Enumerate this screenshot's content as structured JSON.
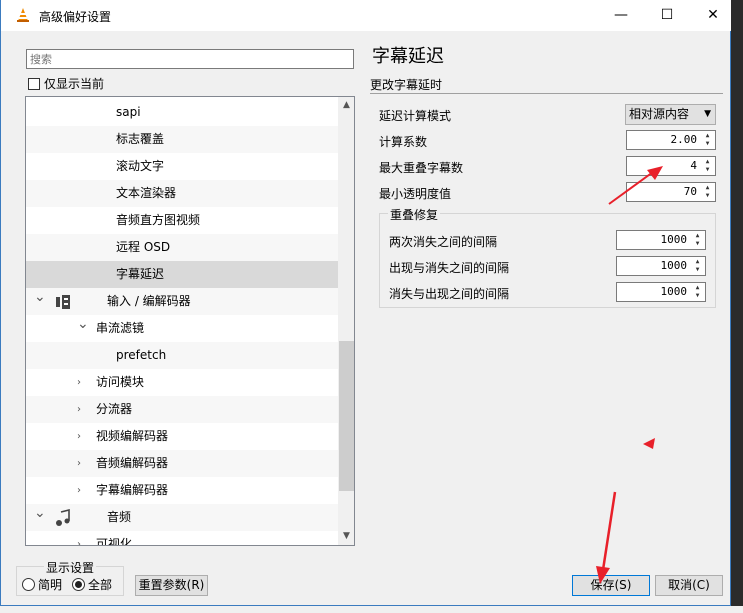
{
  "window": {
    "title": "高级偏好设置",
    "minimize": "—",
    "maximize": "☐",
    "close": "✕"
  },
  "search": {
    "placeholder": "搜索"
  },
  "only_current": "仅显示当前",
  "tree": [
    {
      "label": "sapi",
      "indent": 90,
      "alt": false,
      "sel": false,
      "arrow": ""
    },
    {
      "label": "标志覆盖",
      "indent": 90,
      "alt": true,
      "sel": false,
      "arrow": ""
    },
    {
      "label": "滚动文字",
      "indent": 90,
      "alt": false,
      "sel": false,
      "arrow": ""
    },
    {
      "label": "文本渲染器",
      "indent": 90,
      "alt": true,
      "sel": false,
      "arrow": ""
    },
    {
      "label": "音频直方图视频",
      "indent": 90,
      "alt": false,
      "sel": false,
      "arrow": ""
    },
    {
      "label": "远程 OSD",
      "indent": 90,
      "alt": true,
      "sel": false,
      "arrow": ""
    },
    {
      "label": "字幕延迟",
      "indent": 90,
      "alt": false,
      "sel": true,
      "arrow": ""
    },
    {
      "label": "输入 / 编解码器",
      "indent": 81,
      "alt": true,
      "sel": false,
      "arrow": "expanded",
      "icon": "input-codec-icon"
    },
    {
      "label": "串流滤镜",
      "indent": 70,
      "alt": false,
      "sel": false,
      "arrow": "expanded"
    },
    {
      "label": "prefetch",
      "indent": 90,
      "alt": true,
      "sel": false,
      "arrow": ""
    },
    {
      "label": "访问模块",
      "indent": 70,
      "alt": false,
      "sel": false,
      "arrow": "collapsed"
    },
    {
      "label": "分流器",
      "indent": 70,
      "alt": true,
      "sel": false,
      "arrow": "collapsed"
    },
    {
      "label": "视频编解码器",
      "indent": 70,
      "alt": false,
      "sel": false,
      "arrow": "collapsed"
    },
    {
      "label": "音频编解码器",
      "indent": 70,
      "alt": true,
      "sel": false,
      "arrow": "collapsed"
    },
    {
      "label": "字幕编解码器",
      "indent": 70,
      "alt": false,
      "sel": false,
      "arrow": "collapsed"
    },
    {
      "label": "音频",
      "indent": 81,
      "alt": true,
      "sel": false,
      "arrow": "expanded",
      "icon": "audio-note-icon"
    },
    {
      "label": "可视化",
      "indent": 70,
      "alt": false,
      "sel": false,
      "arrow": "collapsed"
    }
  ],
  "display": {
    "legend": "显示设置",
    "simple": "简明",
    "all": "全部"
  },
  "buttons": {
    "reset": "重置参数(R)",
    "save": "保存(S)",
    "cancel": "取消(C)"
  },
  "panel": {
    "title": "字幕延迟",
    "subtitle": "更改字幕延时",
    "mode_label": "延迟计算模式",
    "mode_value": "相对源内容",
    "factor_label": "计算系数",
    "factor_value": "2.00",
    "overlap_label": "最大重叠字幕数",
    "overlap_value": "4",
    "alpha_label": "最小透明度值",
    "alpha_value": "70",
    "group_legend": "重叠修复",
    "gap1_label": "两次消失之间的间隔",
    "gap1_value": "1000",
    "gap2_label": "出现与消失之间的间隔",
    "gap2_value": "1000",
    "gap3_label": "消失与出现之间的间隔",
    "gap3_value": "1000"
  },
  "colors": {
    "accent": "#0078d7",
    "annotation": "#e8202a",
    "selected": "#d9d9d9"
  }
}
